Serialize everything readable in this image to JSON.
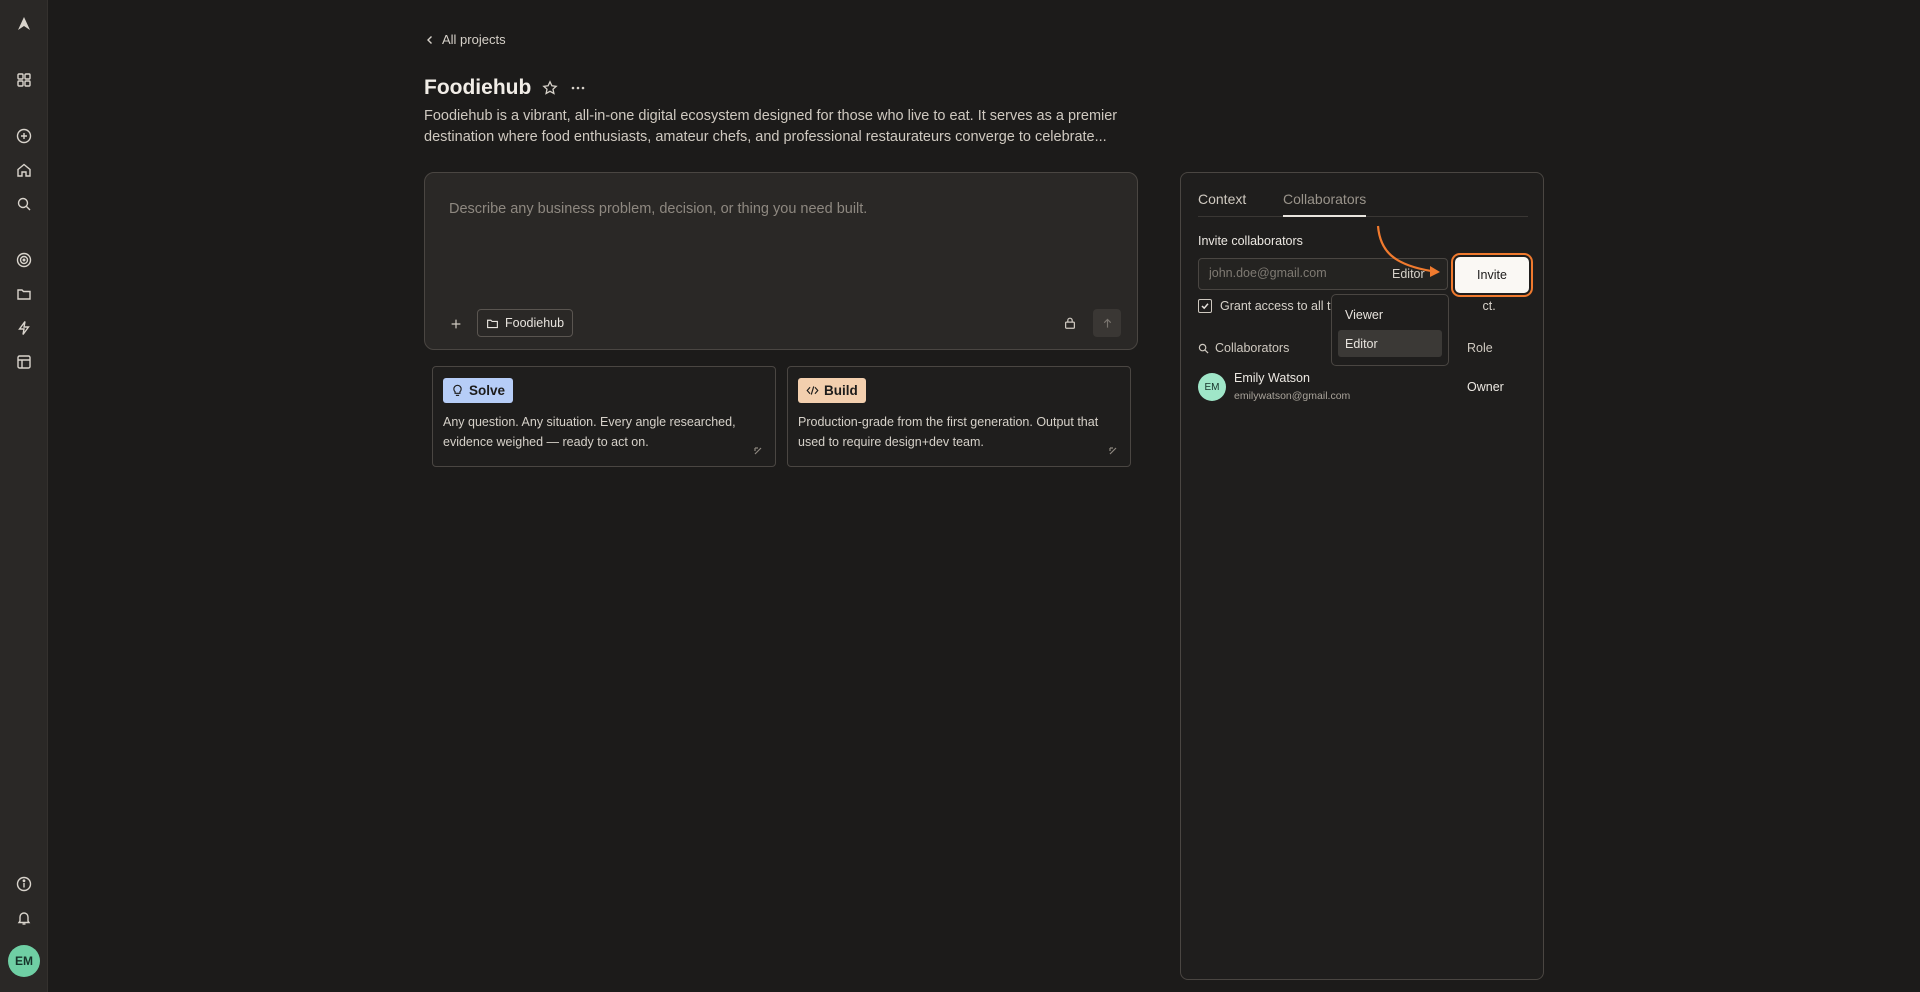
{
  "nav": {
    "back_label": "All projects"
  },
  "project": {
    "title": "Foodiehub",
    "description": "Foodiehub is a vibrant, all-in-one digital ecosystem designed for those who live to eat. It serves as a premier destination where food enthusiasts, amateur chefs, and professional restaurateurs converge to celebrate..."
  },
  "composer": {
    "placeholder": "Describe any business problem, decision, or thing you need built.",
    "project_chip": "Foodiehub"
  },
  "cards": [
    {
      "badge": "Solve",
      "text": "Any question. Any situation. Every angle researched, evidence weighed — ready to act on."
    },
    {
      "badge": "Build",
      "text": "Production-grade from the first generation. Output that used to require design+dev team."
    }
  ],
  "panel": {
    "tabs": [
      {
        "label": "Context"
      },
      {
        "label": "Collaborators"
      }
    ],
    "invite_label": "Invite collaborators",
    "email_placeholder": "john.doe@gmail.com",
    "selected_role": "Editor",
    "invite_button": "Invite",
    "grant_visible_start": "Grant access to all t",
    "grant_visible_end": "ct.",
    "collaborators_header": "Collaborators",
    "role_header": "Role",
    "members": [
      {
        "initials": "EM",
        "name": "Emily Watson",
        "email": "emilywatson@gmail.com",
        "role": "Owner"
      }
    ]
  },
  "role_dropdown": {
    "options": [
      "Viewer",
      "Editor"
    ],
    "selected": "Editor"
  },
  "user": {
    "initials": "EM"
  },
  "colors": {
    "background": "#1c1b1a",
    "accent_annotation": "#f07a2e",
    "solve_badge": "#b6cdf7",
    "build_badge": "#f3cfae",
    "avatar": "#6fcfa4"
  }
}
